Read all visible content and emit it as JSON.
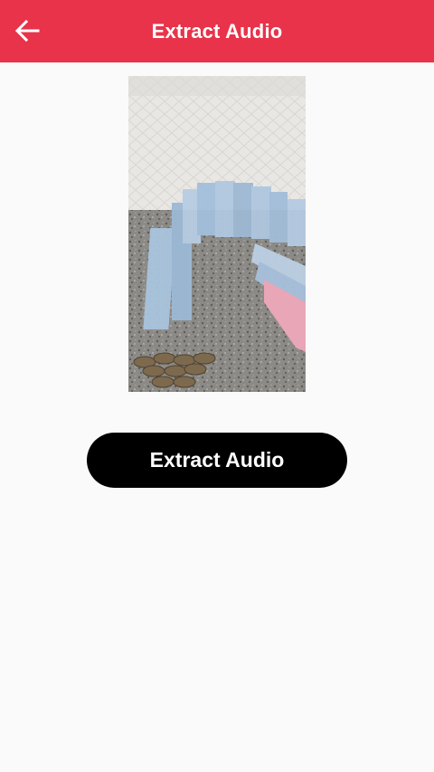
{
  "colors": {
    "appbar": "#e8334a",
    "background": "#fafafa",
    "button": "#000000",
    "button_text": "#ffffff"
  },
  "appbar": {
    "title": "Extract Audio",
    "back_icon": "arrow-left-icon"
  },
  "main": {
    "video_thumbnail": "video-frame-image",
    "extract_button_label": "Extract Audio"
  }
}
